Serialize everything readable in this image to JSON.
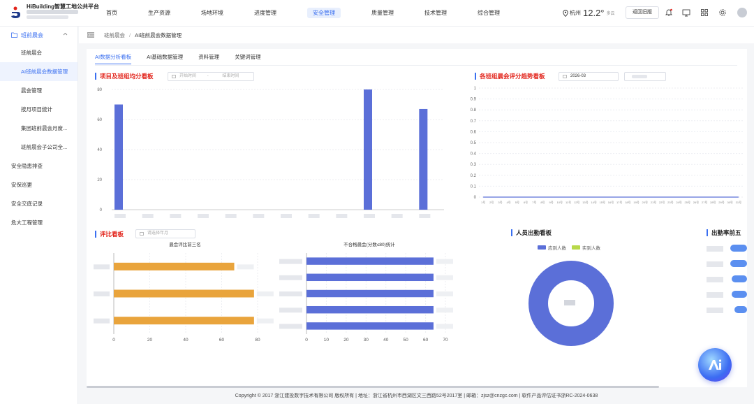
{
  "app": {
    "title": "HiBuilding智慧工地公共平台"
  },
  "nav": {
    "items": [
      "首页",
      "生产资源",
      "场地环境",
      "进度管理",
      "安全管理",
      "质量管理",
      "技术管理",
      "综合管理"
    ],
    "active_index": 4
  },
  "header": {
    "city": "杭州",
    "temperature": "12.2°",
    "condition": "多云",
    "old_version_label": "返回旧版"
  },
  "sidebar": {
    "group_label": "班前晨会",
    "sub_items": [
      "班前晨会",
      "AI班前晨会数据管理",
      "晨会管理",
      "按月项目统计",
      "集团班前晨会月度...",
      "班前晨会子公司全..."
    ],
    "active_sub_index": 1,
    "top_items": [
      "安全隐患排查",
      "安保巡更",
      "安全交底记录",
      "危大工程管理"
    ]
  },
  "breadcrumb": {
    "root": "班前晨会",
    "separator": "/",
    "current": "AI班前晨会数据管理"
  },
  "tabs": {
    "items": [
      "AI数据分析看板",
      "AI基础数据管理",
      "资料管理",
      "关键词管理"
    ],
    "active_index": 0
  },
  "sections": {
    "project_board": {
      "title": "项目及班组均分看板",
      "start_placeholder": "开始时间",
      "range_sep": "-",
      "end_placeholder": "结束时间"
    },
    "trend_board": {
      "title": "各班组晨会评分趋势看板",
      "month_value": "2026-03"
    },
    "rating_board": {
      "title": "评比看板",
      "month_placeholder": "请选择年月"
    },
    "attendance_board": {
      "title": "人员出勤看板",
      "legend": [
        "应到人数",
        "实到人数"
      ]
    },
    "top5_board": {
      "title": "出勤率前五"
    }
  },
  "footer": {
    "text": "Copyright © 2017 浙江建投数字技术有限公司 版权所有 | 地址：浙江省杭州市西湖区文三西路52号2017室 | 邮箱：zjsz@cnzgc.com | 软件产品评估证书浙RC-2024-0638"
  },
  "colors": {
    "accent": "#3a6ff0",
    "bar_blue": "#5b6fd8",
    "bar_orange": "#e9a43c",
    "title_red": "#e2231a",
    "legend_green": "#b8d94a"
  },
  "chart_data": [
    {
      "type": "bar",
      "title": "项目及班组均分看板",
      "categories_count": 12,
      "values": [
        70,
        0,
        0,
        0,
        0,
        0,
        0,
        0,
        0,
        80,
        0,
        67
      ],
      "ylim": [
        0,
        80
      ],
      "yticks": [
        0,
        20,
        40,
        60,
        80
      ],
      "grid": true
    },
    {
      "type": "line",
      "title": "各班组晨会评分趋势看板",
      "x": [
        "1号",
        "2号",
        "3号",
        "4号",
        "5号",
        "6号",
        "7号",
        "8号",
        "9号",
        "10号",
        "11号",
        "12号",
        "13号",
        "14号",
        "15号",
        "16号",
        "17号",
        "18号",
        "19号",
        "20号",
        "21号",
        "22号",
        "23号",
        "24号",
        "25号",
        "26号",
        "27号",
        "28号",
        "29号",
        "30号",
        "31号"
      ],
      "values": [
        0,
        0,
        0,
        0,
        0,
        0,
        0,
        0,
        0,
        0,
        0,
        0,
        0,
        0,
        0,
        0,
        0,
        0,
        0,
        0,
        0,
        0,
        0,
        0,
        0,
        0,
        0,
        0,
        0,
        0,
        0
      ],
      "ylim": [
        0,
        1
      ],
      "yticks": [
        "0",
        "0.1",
        "0.2",
        "0.3",
        "0.4",
        "0.5",
        "0.6",
        "0.7",
        "0.8",
        "0.9",
        "1"
      ],
      "grid": true
    },
    {
      "type": "bar",
      "orientation": "horizontal",
      "title": "晨会评比前三名",
      "values": [
        67,
        78,
        78
      ],
      "xlim": [
        0,
        80
      ],
      "xticks": [
        0,
        20,
        40,
        60,
        80
      ]
    },
    {
      "type": "bar",
      "orientation": "horizontal",
      "title": "不合格晨会(分数≤80)统计",
      "values": [
        64,
        64,
        64,
        64,
        64
      ],
      "xlim": [
        0,
        70
      ],
      "xticks": [
        0,
        10,
        20,
        30,
        40,
        50,
        60,
        70
      ]
    },
    {
      "type": "pie",
      "title": "人员出勤看板",
      "series": [
        {
          "name": "应到人数",
          "value": 1
        },
        {
          "name": "实到人数",
          "value": 0
        }
      ]
    }
  ]
}
